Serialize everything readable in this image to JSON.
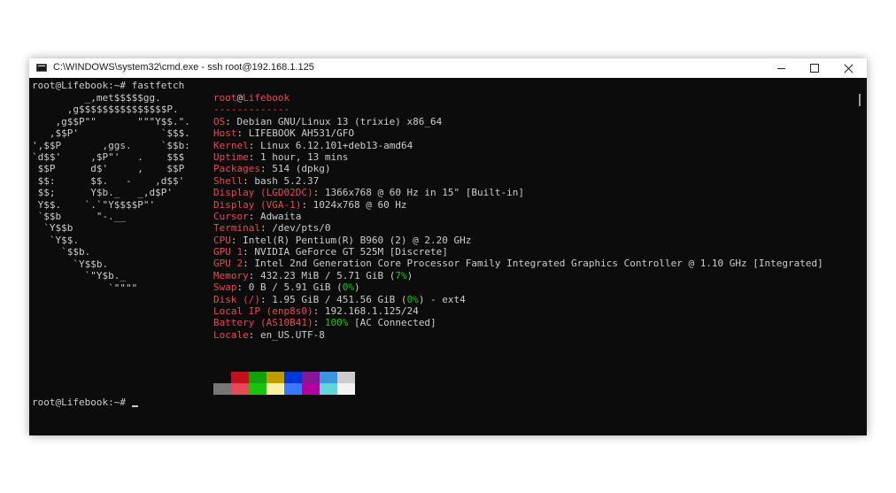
{
  "window": {
    "title": "C:\\WINDOWS\\system32\\cmd.exe - ssh  root@192.168.1.125"
  },
  "terminal": {
    "command_line": "root@Lifebook:~# fastfetch",
    "final_prompt": "root@Lifebook:~# ",
    "logo_lines": [
      "         _,met$$$$$gg.",
      "      ,g$$$$$$$$$$$$$$$P.",
      "    ,g$$P\"\"       \"\"\"Y$$.\".",
      "   ,$$P'              `$$$.",
      "',$$P       ,ggs.     `$$b:",
      "`d$$'     ,$P\"'   .    $$$",
      " $$P      d$'     ,    $$P",
      " $$:      $$.   -    ,d$$'",
      " $$;      Y$b._   _,d$P'",
      " Y$$.    `.`\"Y$$$$P\"'",
      " `$$b      \"-.__",
      "  `Y$$b",
      "   `Y$$.",
      "     `$$b.",
      "       `Y$$b.",
      "         `\"Y$b._",
      "             `\"\"\"\""
    ],
    "header": {
      "user": "root",
      "at": "@",
      "host": "Lifebook",
      "separator": "-------------"
    },
    "info": [
      {
        "key": "OS",
        "segments": [
          {
            "t": "Debian GNU/Linux 13 (trixie) x86_64"
          }
        ]
      },
      {
        "key": "Host",
        "segments": [
          {
            "t": "LIFEBOOK AH531/GFO"
          }
        ]
      },
      {
        "key": "Kernel",
        "segments": [
          {
            "t": "Linux 6.12.101+deb13-amd64"
          }
        ]
      },
      {
        "key": "Uptime",
        "segments": [
          {
            "t": "1 hour, 13 mins"
          }
        ]
      },
      {
        "key": "Packages",
        "segments": [
          {
            "t": "514 (dpkg)"
          }
        ]
      },
      {
        "key": "Shell",
        "segments": [
          {
            "t": "bash 5.2.37"
          }
        ]
      },
      {
        "key": "Display (LGD02DC)",
        "segments": [
          {
            "t": "1366x768 @ 60 Hz in 15\" [Built-in]"
          }
        ]
      },
      {
        "key": "Display (VGA-1)",
        "segments": [
          {
            "t": "1024x768 @ 60 Hz"
          }
        ]
      },
      {
        "key": "Cursor",
        "segments": [
          {
            "t": "Adwaita"
          }
        ]
      },
      {
        "key": "Terminal",
        "segments": [
          {
            "t": "/dev/pts/0"
          }
        ]
      },
      {
        "key": "CPU",
        "segments": [
          {
            "t": "Intel(R) Pentium(R) B960 (2) @ 2.20 GHz"
          }
        ]
      },
      {
        "key": "GPU 1",
        "segments": [
          {
            "t": "NVIDIA GeForce GT 525M [Discrete]"
          }
        ]
      },
      {
        "key": "GPU 2",
        "segments": [
          {
            "t": "Intel 2nd Generation Core Processor Family Integrated Graphics Controller @ 1.10 GHz [Integrated]"
          }
        ]
      },
      {
        "key": "Memory",
        "segments": [
          {
            "t": "432.23 MiB / 5.71 GiB ("
          },
          {
            "t": "7%",
            "c": "g"
          },
          {
            "t": ")"
          }
        ]
      },
      {
        "key": "Swap",
        "segments": [
          {
            "t": "0 B / 5.91 GiB ("
          },
          {
            "t": "0%",
            "c": "g"
          },
          {
            "t": ")"
          }
        ]
      },
      {
        "key": "Disk (/)",
        "segments": [
          {
            "t": "1.95 GiB / 451.56 GiB ("
          },
          {
            "t": "0%",
            "c": "g"
          },
          {
            "t": ") - ext4"
          }
        ]
      },
      {
        "key": "Local IP (enp8s0)",
        "segments": [
          {
            "t": "192.168.1.125/24"
          }
        ]
      },
      {
        "key": "Battery (AS10B41)",
        "segments": [
          {
            "t": "100%",
            "c": "g"
          },
          {
            "t": " [AC Connected]"
          }
        ]
      },
      {
        "key": "Locale",
        "segments": [
          {
            "t": "en_US.UTF-8"
          }
        ]
      }
    ],
    "palette": {
      "normal": [
        "#0c0c0c",
        "#c50f1f",
        "#13a10e",
        "#c19c00",
        "#0037da",
        "#881798",
        "#3a96dd",
        "#cccccc"
      ],
      "bright": [
        "#767676",
        "#e74856",
        "#16c60c",
        "#f9f1a5",
        "#3b78ff",
        "#b4009e",
        "#61d6d6",
        "#f2f2f2"
      ]
    }
  }
}
